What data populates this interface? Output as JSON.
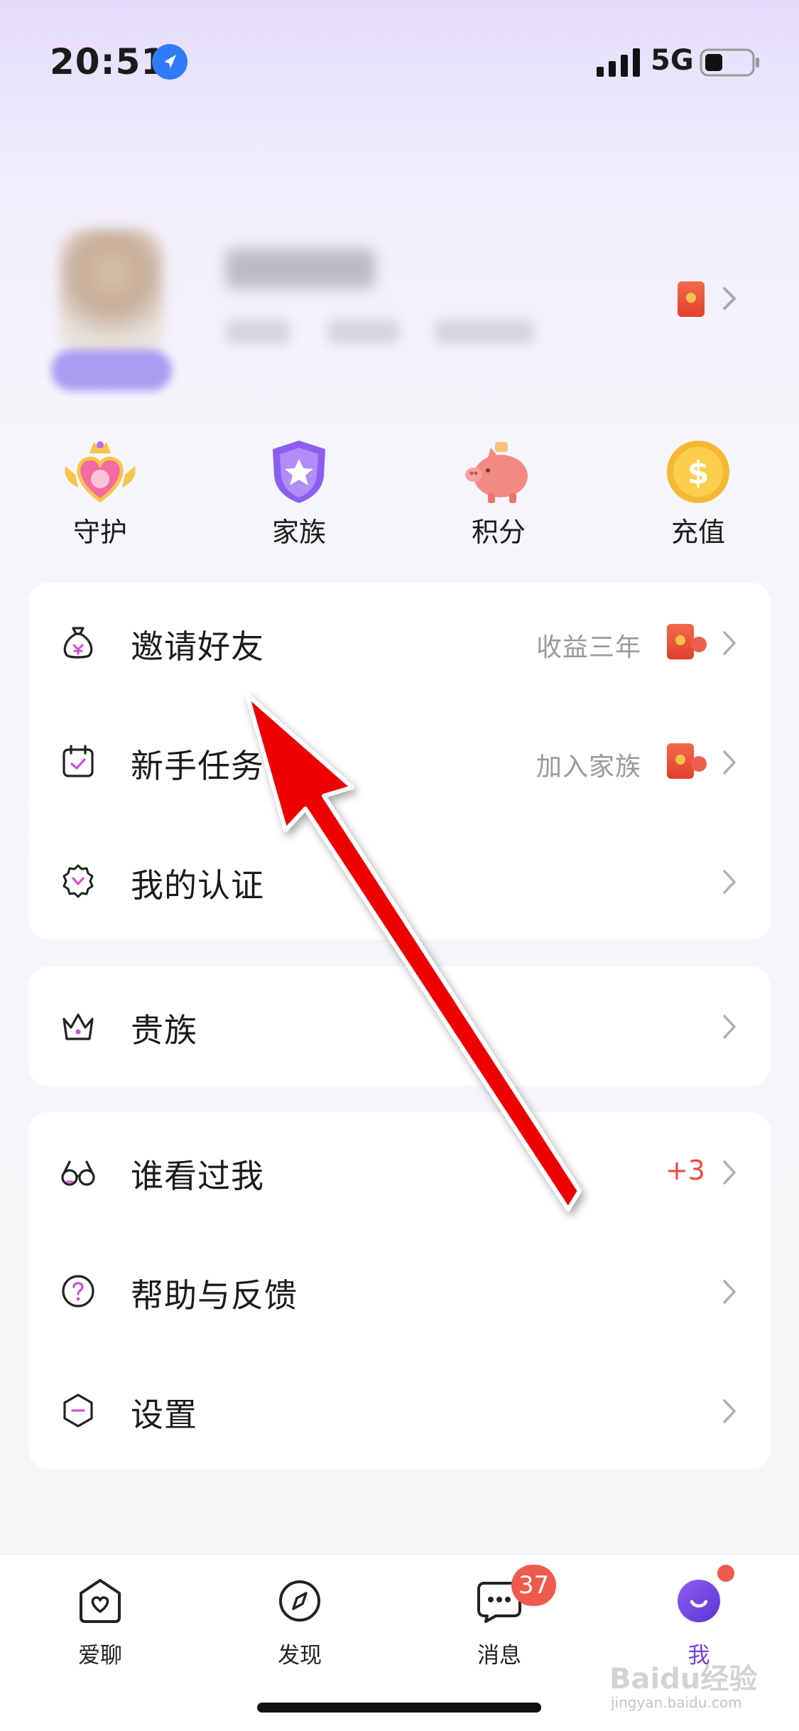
{
  "status_bar": {
    "time": "20:51",
    "network": "5G"
  },
  "quick_actions": [
    {
      "label": "守护",
      "icon": "heart-crown-icon"
    },
    {
      "label": "家族",
      "icon": "shield-star-icon"
    },
    {
      "label": "积分",
      "icon": "piggy-bank-icon"
    },
    {
      "label": "充值",
      "icon": "dollar-coin-icon"
    }
  ],
  "menu_group_1": [
    {
      "label": "邀请好友",
      "sub": "收益三年",
      "icon": "money-bag-icon"
    },
    {
      "label": "新手任务",
      "sub": "加入家族",
      "icon": "calendar-check-icon"
    },
    {
      "label": "我的认证",
      "sub": "",
      "icon": "badge-check-icon"
    }
  ],
  "menu_group_2": [
    {
      "label": "贵族",
      "icon": "crown-icon"
    }
  ],
  "menu_group_3": [
    {
      "label": "谁看过我",
      "count": "+3",
      "icon": "glasses-icon"
    },
    {
      "label": "帮助与反馈",
      "icon": "help-circle-icon"
    },
    {
      "label": "设置",
      "icon": "hexagon-settings-icon"
    }
  ],
  "tabbar": {
    "tabs": [
      {
        "label": "爱聊",
        "icon": "home-heart-icon"
      },
      {
        "label": "发现",
        "icon": "compass-icon"
      },
      {
        "label": "消息",
        "icon": "chat-bubble-icon"
      },
      {
        "label": "我",
        "icon": "smile-face-icon"
      }
    ],
    "message_count": "37",
    "active_color": "#6d43e0"
  },
  "watermark": {
    "text": "Baidu经验",
    "sub": "jingyan.baidu.com"
  },
  "colors": {
    "accent": "#6d43e0",
    "badge_red": "#ee5a4c",
    "count_red": "#ef4a46"
  }
}
